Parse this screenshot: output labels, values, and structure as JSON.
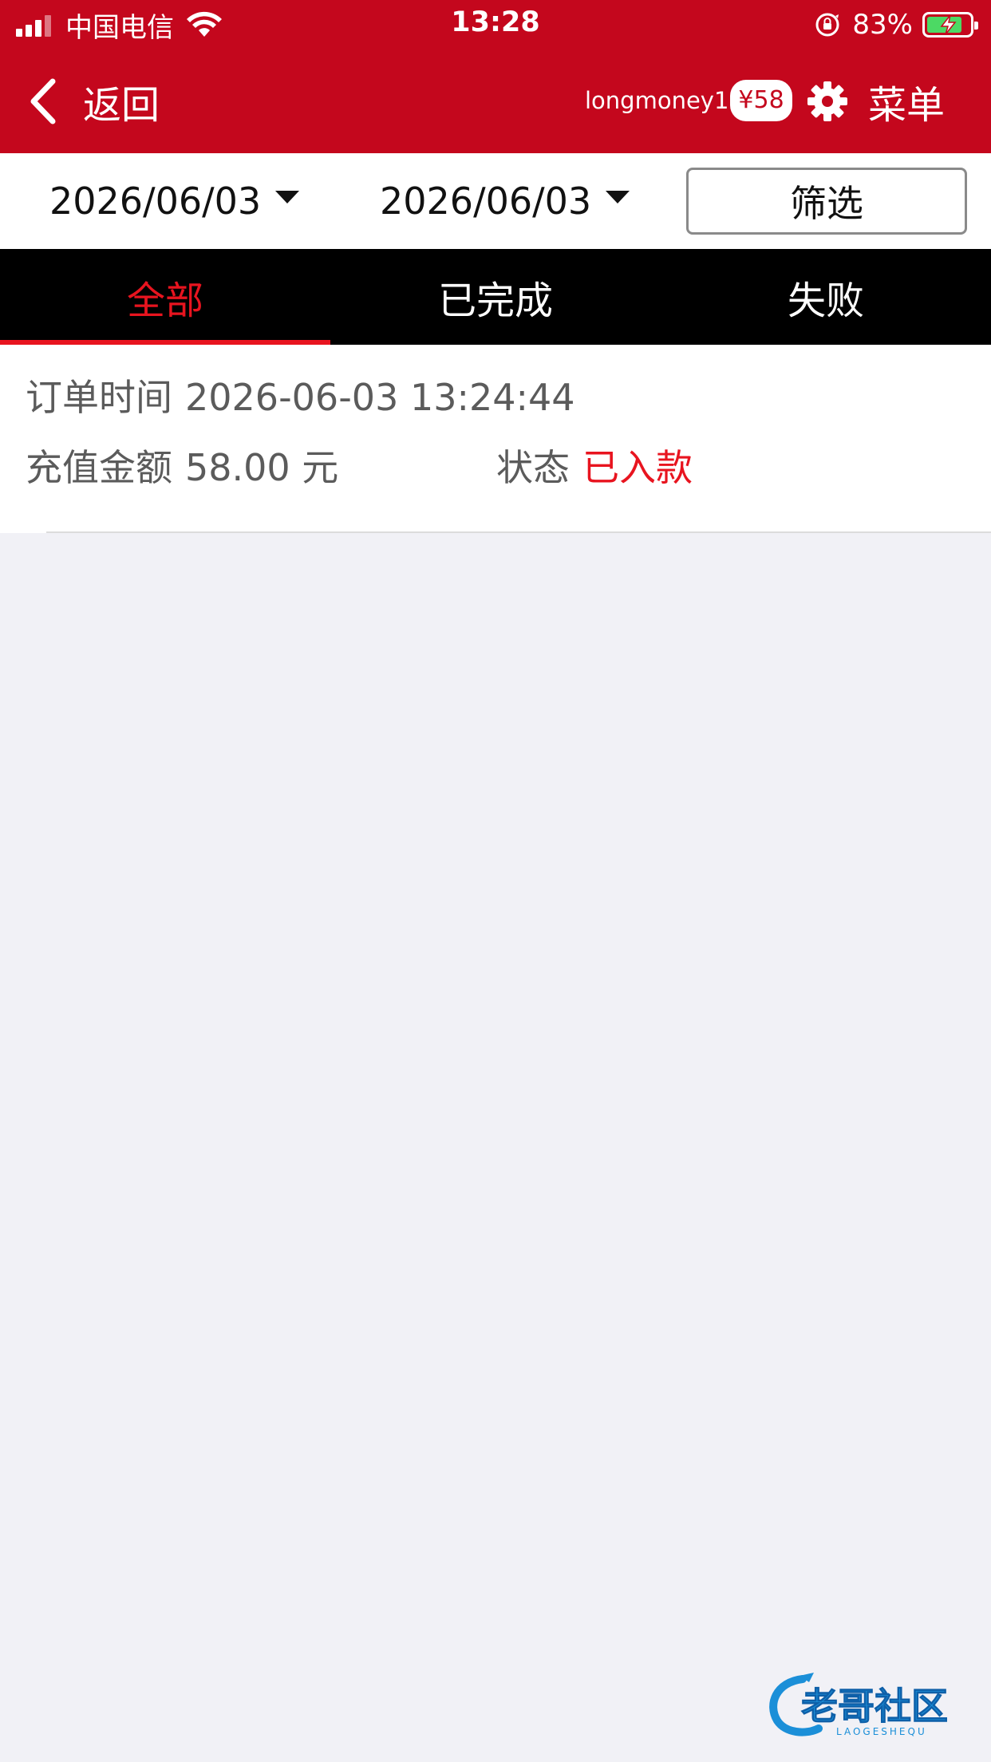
{
  "status_bar": {
    "carrier": "中国电信",
    "time": "13:28",
    "battery_percent": "83%",
    "battery_level": 0.83,
    "icons": [
      "signal-icon",
      "wifi-icon",
      "orientation-lock-icon",
      "battery-charging-icon"
    ]
  },
  "nav": {
    "back_label": "返回",
    "username": "longmoney1",
    "balance": "¥58",
    "menu_label": "菜单",
    "icons": [
      "chevron-left-icon",
      "gear-icon"
    ]
  },
  "filter": {
    "start_date": "2026/06/03",
    "end_date": "2026/06/03",
    "filter_label": "筛选"
  },
  "tabs": [
    {
      "label": "全部",
      "active": true
    },
    {
      "label": "已完成",
      "active": false
    },
    {
      "label": "失败",
      "active": false
    }
  ],
  "orders": [
    {
      "time_label": "订单时间",
      "time_value": "2026-06-03 13:24:44",
      "amount_label": "充值金额",
      "amount_value": "58.00 元",
      "status_label": "状态",
      "status_value": "已入款"
    }
  ],
  "watermark": {
    "text": "老哥社区",
    "subtext": "LAOGESHEQU"
  },
  "colors": {
    "brand_red": "#c4071d",
    "accent_red": "#e8141f",
    "tab_bar_bg": "#000000",
    "page_bg": "#f1f1f6",
    "battery_green": "#4cd964"
  }
}
